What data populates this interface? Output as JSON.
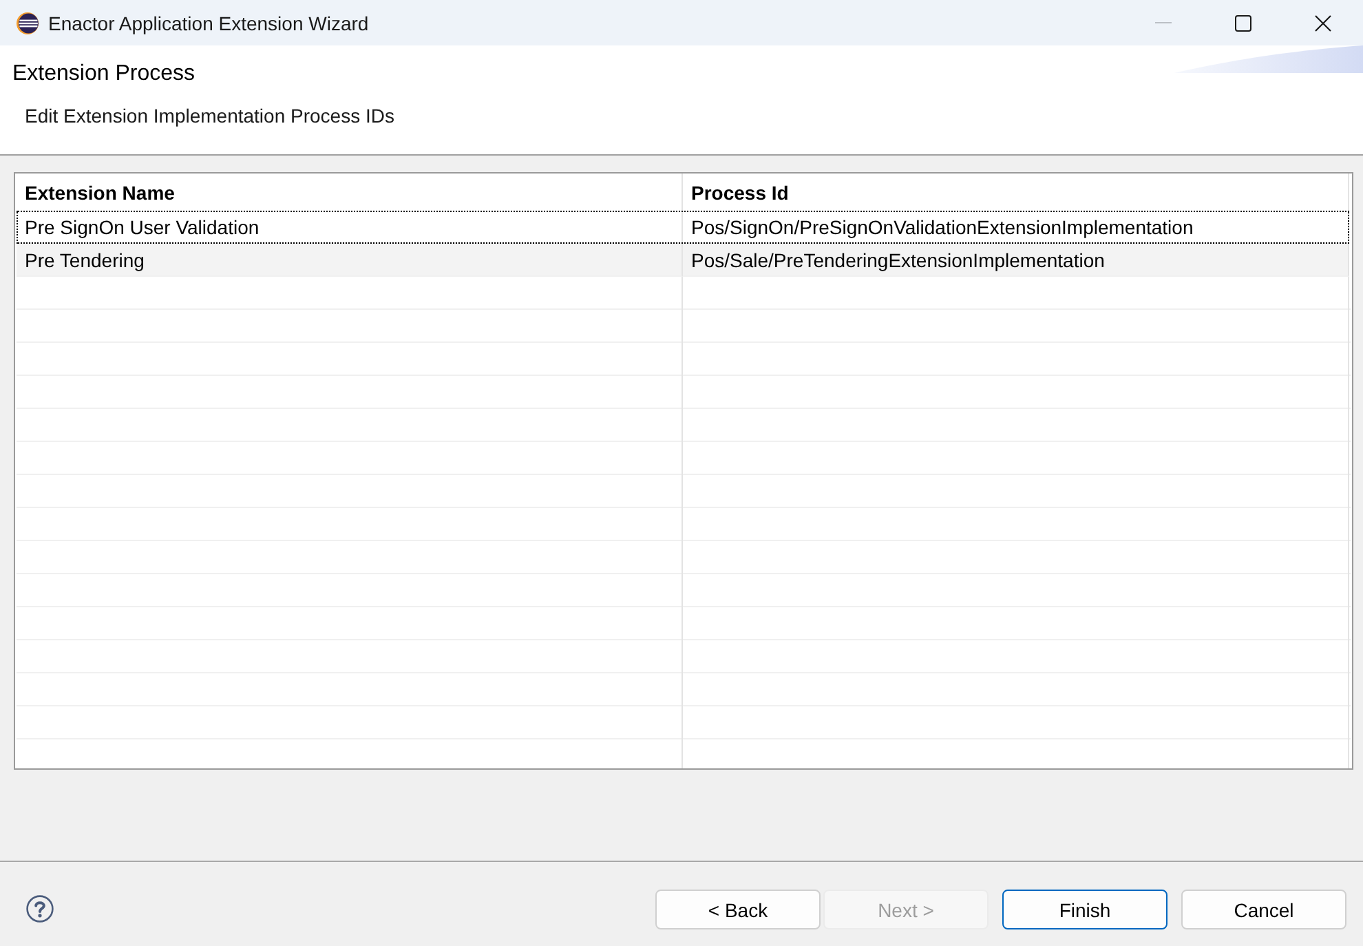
{
  "window": {
    "title": "Enactor Application Extension Wizard",
    "controls": [
      {
        "kind": "minimize",
        "disabled": true
      },
      {
        "kind": "maximize",
        "disabled": false
      },
      {
        "kind": "close",
        "disabled": false
      }
    ]
  },
  "header": {
    "title": "Extension Process",
    "description": "Edit Extension Implementation Process IDs"
  },
  "table": {
    "columns": [
      "Extension Name",
      "Process Id"
    ],
    "rows": [
      {
        "cells": [
          "Pre SignOn User Validation",
          "Pos/SignOn/PreSignOnValidationExtensionImplementation"
        ],
        "focused": true,
        "hovered": false
      },
      {
        "cells": [
          "Pre Tendering",
          "Pos/Sale/PreTenderingExtensionImplementation"
        ],
        "focused": false,
        "hovered": true
      }
    ]
  },
  "footer": {
    "buttons": [
      {
        "label": "< Back",
        "disabled": false,
        "default": false
      },
      {
        "label": "Next >",
        "disabled": true,
        "default": false
      },
      {
        "label": "Finish",
        "disabled": false,
        "default": true
      },
      {
        "label": "Cancel",
        "disabled": false,
        "default": false
      }
    ]
  }
}
